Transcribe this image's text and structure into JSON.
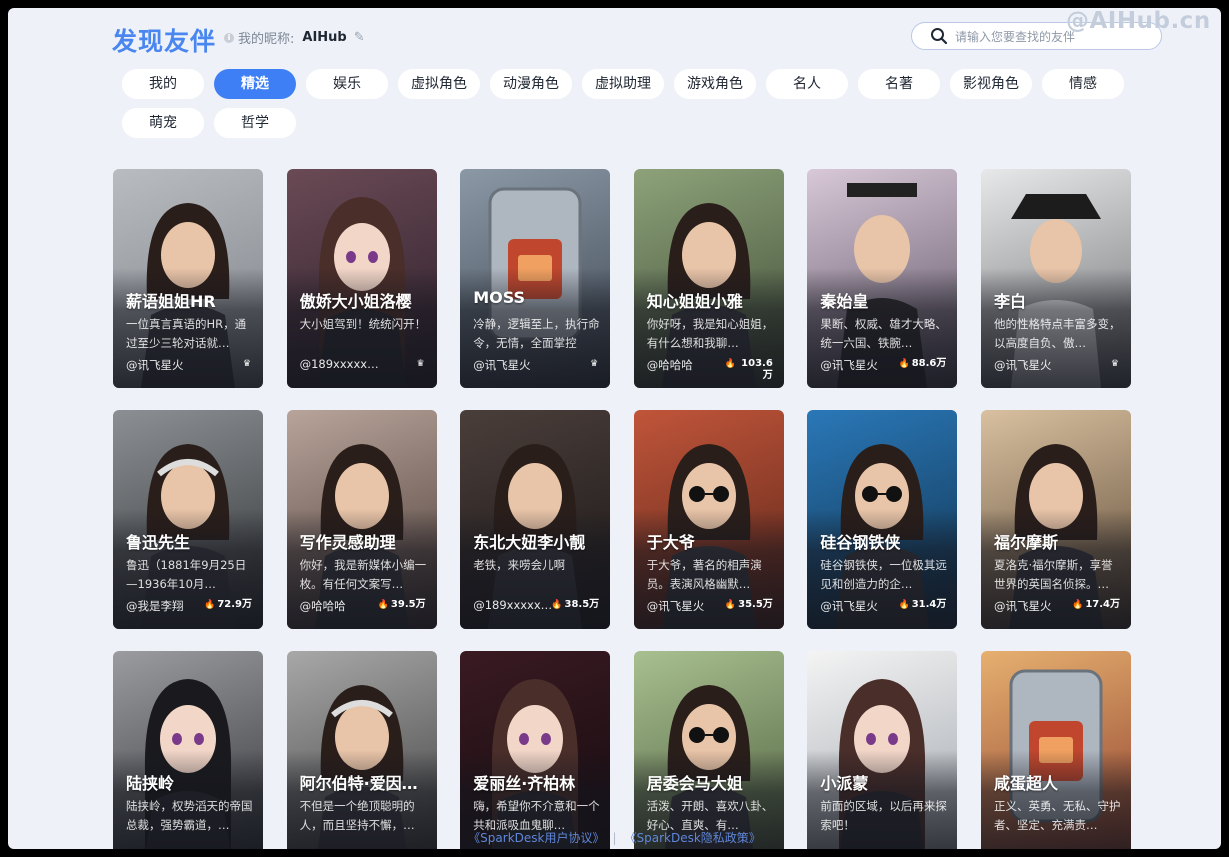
{
  "header": {
    "title": "发现友伴",
    "nickname_label": "我的昵称:",
    "nickname_value": "AIHub",
    "search_placeholder": "请输入您要查找的友伴",
    "watermark": "@AIHub.cn"
  },
  "tabs": [
    {
      "label": "我的",
      "active": false
    },
    {
      "label": "精选",
      "active": true
    },
    {
      "label": "娱乐",
      "active": false
    },
    {
      "label": "虚拟角色",
      "active": false
    },
    {
      "label": "动漫角色",
      "active": false
    },
    {
      "label": "虚拟助理",
      "active": false
    },
    {
      "label": "游戏角色",
      "active": false
    },
    {
      "label": "名人",
      "active": false
    },
    {
      "label": "名著",
      "active": false
    },
    {
      "label": "影视角色",
      "active": false
    },
    {
      "label": "情感",
      "active": false
    },
    {
      "label": "萌宠",
      "active": false
    },
    {
      "label": "哲学",
      "active": false
    }
  ],
  "cards": [
    {
      "name": "薪语姐姐HR",
      "desc": "一位真言真语的HR，通过至少三轮对话就…",
      "author": "@讯飞星火",
      "stat": "",
      "badge": "crown",
      "palette": [
        "#b9bcc0",
        "#7b7f86"
      ],
      "portrait": "woman"
    },
    {
      "name": "傲娇大小姐洛樱",
      "desc": "大小姐驾到！统统闪开！",
      "author": "@189xxxxx…",
      "stat": "",
      "badge": "crown",
      "palette": [
        "#6a4a55",
        "#2a1e2a"
      ],
      "portrait": "anime"
    },
    {
      "name": "MOSS",
      "desc": "冷静，逻辑至上，执行命令，无情，全面掌控",
      "author": "@讯飞星火",
      "stat": "",
      "badge": "crown",
      "palette": [
        "#8b98a6",
        "#3c4550"
      ],
      "portrait": "robot"
    },
    {
      "name": "知心姐姐小雅",
      "desc": "你好呀，我是知心姐姐，有什么想和我聊…",
      "author": "@哈哈哈",
      "stat": "103.6万",
      "badge": "flame",
      "palette": [
        "#8da27a",
        "#3e4a34"
      ],
      "portrait": "woman"
    },
    {
      "name": "秦始皇",
      "desc": "果断、权威、雄才大略、统一六国、铁腕…",
      "author": "@讯飞星火",
      "stat": "88.6万",
      "badge": "flame",
      "palette": [
        "#d8c8d8",
        "#5a5060"
      ],
      "portrait": "emperor"
    },
    {
      "name": "李白",
      "desc": "他的性格特点丰富多变，以高度自负、傲…",
      "author": "@讯飞星火",
      "stat": "",
      "badge": "crown",
      "palette": [
        "#e6e8ea",
        "#6c6e70"
      ],
      "portrait": "scholar"
    },
    {
      "name": "鲁迅先生",
      "desc": "鲁迅（1881年9月25日—1936年10月…",
      "author": "@我是李翔",
      "stat": "72.9万",
      "badge": "flame",
      "palette": [
        "#8c9094",
        "#303234"
      ],
      "portrait": "oldman"
    },
    {
      "name": "写作灵感助理",
      "desc": "你好，我是新媒体小编一枚。有任何文案写…",
      "author": "@哈哈哈",
      "stat": "39.5万",
      "badge": "flame",
      "palette": [
        "#b8a49a",
        "#4a3a36"
      ],
      "portrait": "woman"
    },
    {
      "name": "东北大妞李小靓",
      "desc": "老铁，来唠会儿啊",
      "author": "@189xxxxx…",
      "stat": "38.5万",
      "badge": "flame",
      "palette": [
        "#4a3e3a",
        "#1a1616"
      ],
      "portrait": "woman"
    },
    {
      "name": "于大爷",
      "desc": "于大爷，著名的相声演员。表演风格幽默…",
      "author": "@讯飞星火",
      "stat": "35.5万",
      "badge": "flame",
      "palette": [
        "#c0553a",
        "#5a2418"
      ],
      "portrait": "glasses"
    },
    {
      "name": "硅谷钢铁侠",
      "desc": "硅谷钢铁侠，一位极其远见和创造力的企…",
      "author": "@讯飞星火",
      "stat": "31.4万",
      "badge": "flame",
      "palette": [
        "#2a78b8",
        "#10304a"
      ],
      "portrait": "glasses"
    },
    {
      "name": "福尔摩斯",
      "desc": "夏洛克·福尔摩斯，享誉世界的英国名侦探。…",
      "author": "@讯飞星火",
      "stat": "17.4万",
      "badge": "flame",
      "palette": [
        "#d8c0a0",
        "#5a4632"
      ],
      "portrait": "detective"
    },
    {
      "name": "陆挟岭",
      "desc": "陆挟岭，权势滔天的帝国总裁，强势霸道，…",
      "author": "",
      "stat": "",
      "badge": "",
      "palette": [
        "#9a9ca0",
        "#2e3034"
      ],
      "portrait": "anime-man"
    },
    {
      "name": "阿尔伯特·爱因…",
      "desc": "不但是一个绝顶聪明的人，而且坚持不懈，…",
      "author": "",
      "stat": "",
      "badge": "",
      "palette": [
        "#a8a8a8",
        "#3a3a3a"
      ],
      "portrait": "oldman"
    },
    {
      "name": "爱丽丝·齐柏林",
      "desc": "嗨，希望你不介意和一个共和派吸血鬼聊…",
      "author": "",
      "stat": "",
      "badge": "",
      "palette": [
        "#3a1a22",
        "#120a0e"
      ],
      "portrait": "anime"
    },
    {
      "name": "居委会马大姐",
      "desc": "活泼、开朗、喜欢八卦、好心、直爽、有…",
      "author": "",
      "stat": "",
      "badge": "",
      "palette": [
        "#a8c090",
        "#4a5a3a"
      ],
      "portrait": "glasses"
    },
    {
      "name": "小派蒙",
      "desc": "前面的区域，以后再来探索吧！",
      "author": "",
      "stat": "",
      "badge": "",
      "palette": [
        "#f4f4f4",
        "#9aa0a8"
      ],
      "portrait": "anime"
    },
    {
      "name": "咸蛋超人",
      "desc": "正义、英勇、无私、守护者、坚定、充满责…",
      "author": "",
      "stat": "",
      "badge": "",
      "palette": [
        "#e6b070",
        "#8a3a2a"
      ],
      "portrait": "robot"
    }
  ],
  "footer": {
    "agreement": "《SparkDesk用户协议》",
    "separator": "|",
    "privacy": "《SparkDesk隐私政策》"
  }
}
